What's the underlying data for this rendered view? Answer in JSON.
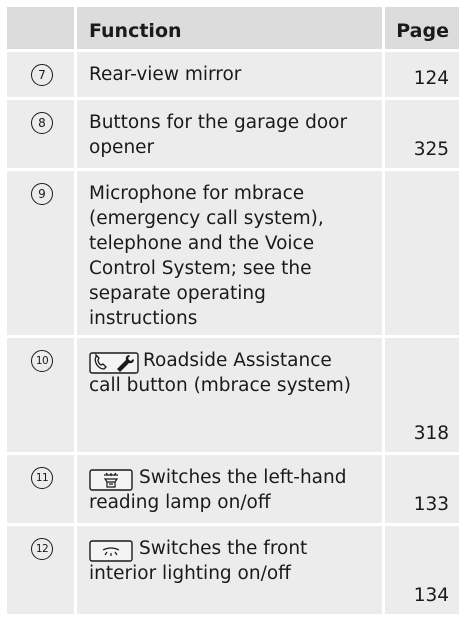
{
  "header": {
    "function_label": "Function",
    "page_label": "Page"
  },
  "rows": [
    {
      "num": "7",
      "text": "Rear-view mirror",
      "page": "124"
    },
    {
      "num": "8",
      "text": "Buttons for the garage door opener",
      "page": "325"
    },
    {
      "num": "9",
      "text": "Microphone for mbrace (emergency call system), telephone and the Voice Control System; see the separate operating instructions",
      "page": ""
    },
    {
      "num": "10",
      "text": "Roadside Assistance call button (mbrace system)",
      "page": "318",
      "icon": "phone-wrench-icon"
    },
    {
      "num": "11",
      "text": "Switches the left-hand reading lamp on/off",
      "page": "133",
      "icon": "reading-lamp-icon"
    },
    {
      "num": "12",
      "text": "Switches the front interior lighting on/off",
      "page": "134",
      "icon": "interior-light-icon"
    }
  ]
}
